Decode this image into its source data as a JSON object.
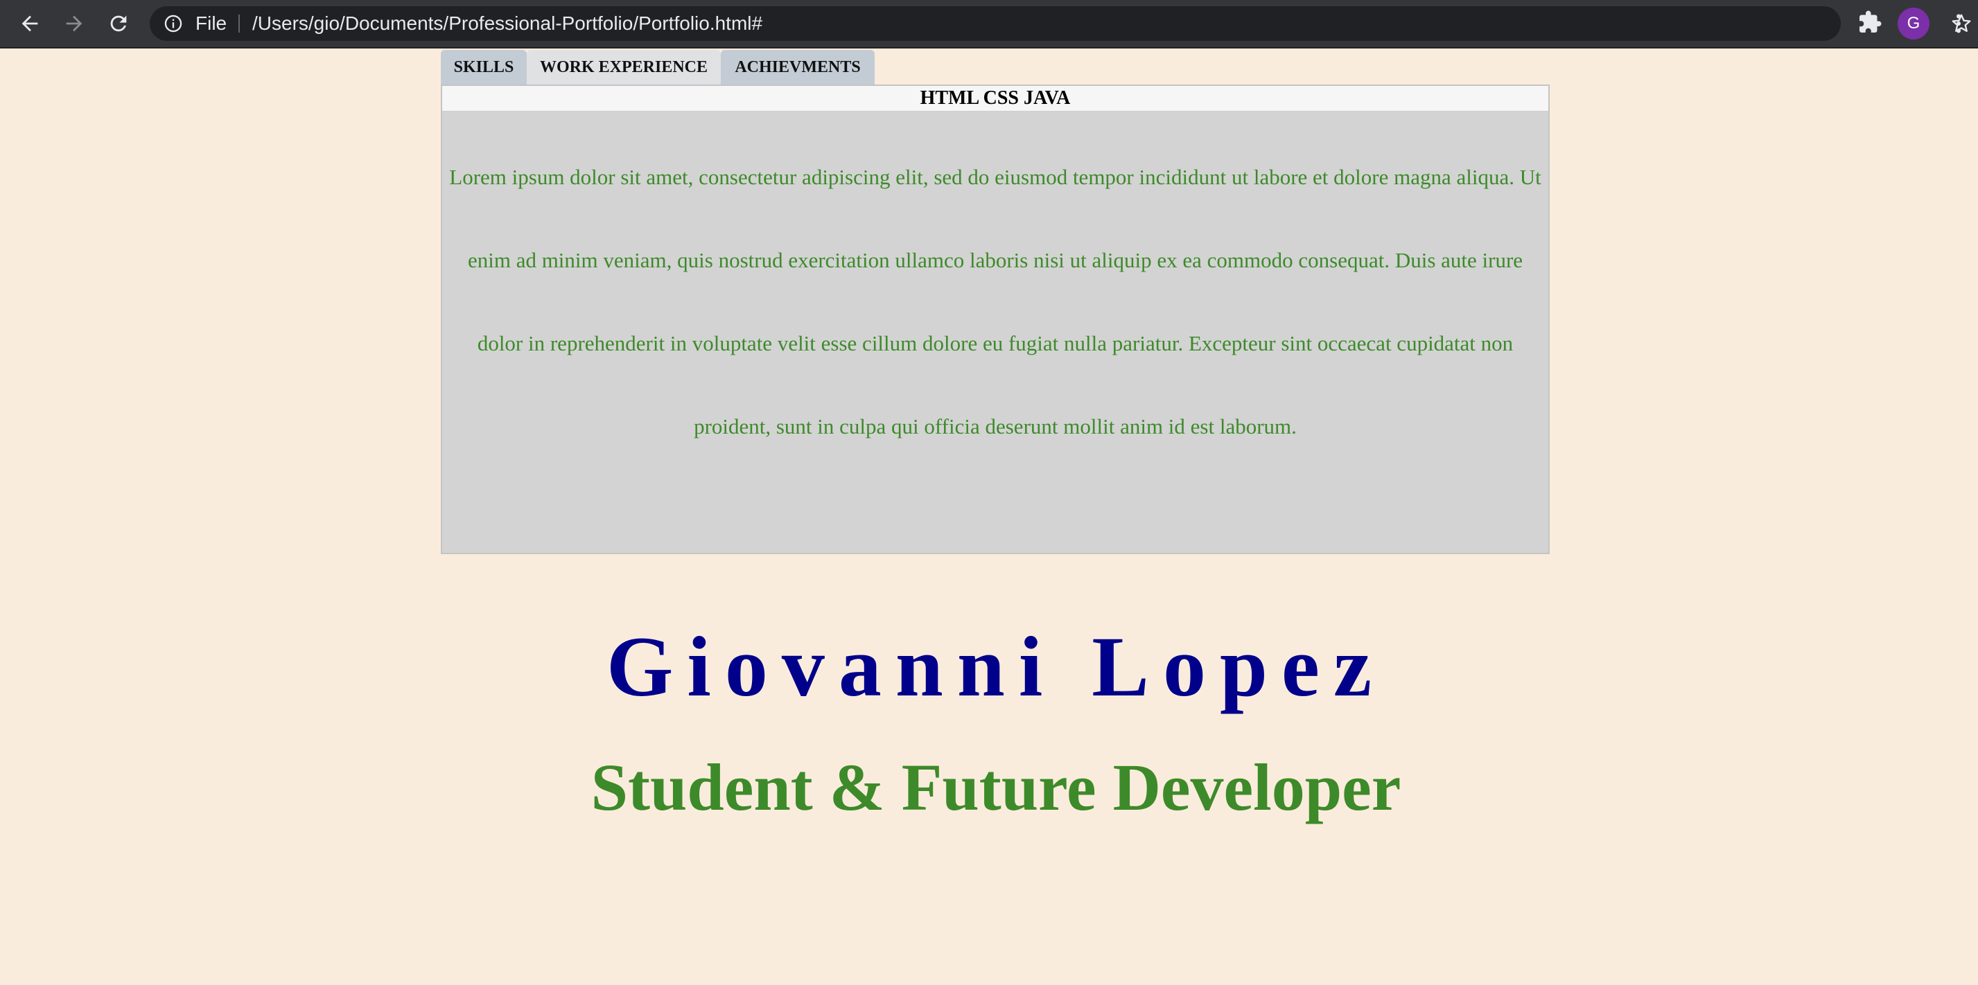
{
  "browser": {
    "file_label": "File",
    "url": "/Users/gio/Documents/Professional-Portfolio/Portfolio.html#",
    "avatar_letter": "G",
    "icons": [
      "back-arrow-icon",
      "forward-arrow-icon",
      "reload-icon",
      "info-icon",
      "star-icon",
      "extensions-puzzle-icon",
      "menu-dots-icon"
    ]
  },
  "tabs": [
    {
      "label": "SKILLS"
    },
    {
      "label": "WORK EXPERIENCE"
    },
    {
      "label": "ACHIEVMENTS"
    }
  ],
  "panel": {
    "header": "HTML CSS JAVA",
    "body": "Lorem ipsum dolor sit amet, consectetur adipiscing elit, sed do eiusmod tempor incididunt ut labore et dolore magna aliqua. Ut enim ad minim veniam, quis nostrud exercitation ullamco laboris nisi ut aliquip ex ea commodo consequat. Duis aute irure dolor in reprehenderit in voluptate velit esse cillum dolore eu fugiat nulla pariatur. Excepteur sint occaecat cupidatat non proident, sunt in culpa qui officia deserunt mollit anim id est laborum."
  },
  "hero": {
    "name": "Giovanni Lopez",
    "subtitle": "Student & Future Developer"
  },
  "colors": {
    "page_background": "#faecdc",
    "name": "#00008b",
    "accent_green": "#3d8a2a",
    "panel": "#d3d3d3",
    "avatar": "#7b2fa8"
  }
}
